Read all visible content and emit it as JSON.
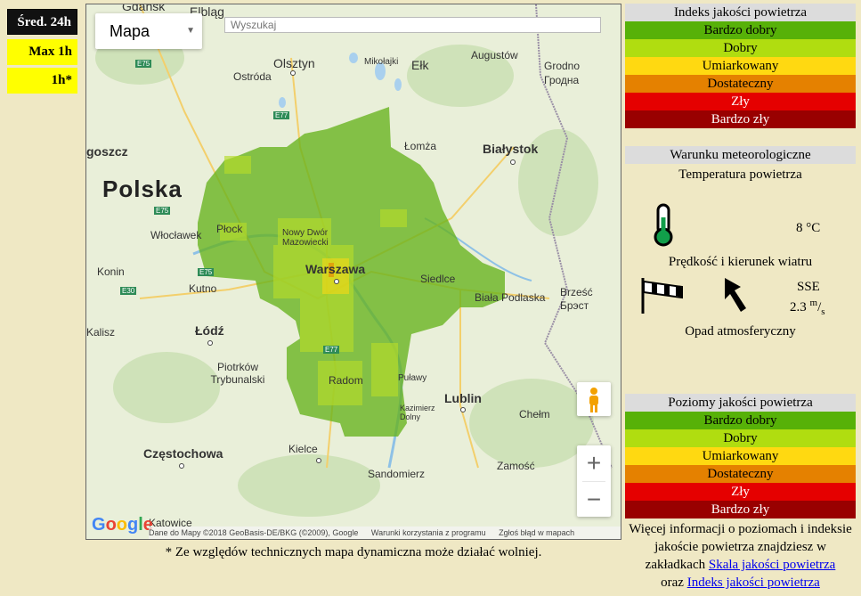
{
  "modes": {
    "avg24": "Śred. 24h",
    "max1h": "Max 1h",
    "h1": "1h*"
  },
  "map": {
    "type_label": "Mapa",
    "search_placeholder": "Wyszukaj",
    "country": "Polska",
    "cities": {
      "gdansk": "Gdańsk",
      "elblag": "Elbląg",
      "olsztyn": "Olsztyn",
      "ostroda": "Ostróda",
      "mikolajki": "Mikołajki",
      "elk": "Ełk",
      "augustow": "Augustów",
      "grodno": "Grodno",
      "grodno_by": "Гродна",
      "lomza": "Łomża",
      "bialystok": "Białystok",
      "goszcz": "goszcz",
      "plock": "Płock",
      "wloclawek": "Włocławek",
      "nowydwor": "Nowy Dwór Mazowiecki",
      "warszawa": "Warszawa",
      "siedlce": "Siedlce",
      "biala": "Biała Podlaska",
      "brzesc": "Brześć",
      "brest_by": "Брэст",
      "konin": "Konin",
      "kutno": "Kutno",
      "kalisz": "Kalisz",
      "lodz": "Łódź",
      "piotrkow": "Piotrków Trybunalski",
      "radom": "Radom",
      "pulawy": "Puławy",
      "kazimierz": "Kazimierz Dolny",
      "lublin": "Lublin",
      "chelm": "Chełm",
      "czestochowa": "Częstochowa",
      "kielce": "Kielce",
      "sandomierz": "Sandomierz",
      "zamosc": "Zamość",
      "katowice": "Katowice"
    },
    "roads": {
      "e75a": "E75",
      "e77a": "E77",
      "e75b": "E75",
      "e75c": "E75",
      "e30": "E30",
      "e77b": "E77"
    },
    "attribution": {
      "data": "Dane do Mapy ©2018 GeoBasis-DE/BKG (©2009), Google",
      "terms": "Warunki korzystania z programu",
      "report": "Zgłoś błąd w mapach"
    },
    "google": "Google"
  },
  "note": "* Ze względów technicznych mapa dynamiczna może działać wolniej.",
  "index_panel": {
    "title": "Indeks jakości powietrza",
    "levels": [
      {
        "label": "Bardzo dobry",
        "color": "#57b108",
        "text": "#000000"
      },
      {
        "label": "Dobry",
        "color": "#b0dd10",
        "text": "#000000"
      },
      {
        "label": "Umiarkowany",
        "color": "#ffd911",
        "text": "#000000"
      },
      {
        "label": "Dostateczny",
        "color": "#e58100",
        "text": "#000000"
      },
      {
        "label": "Zły",
        "color": "#e50000",
        "text": "#ffffff"
      },
      {
        "label": "Bardzo zły",
        "color": "#990000",
        "text": "#ffffff"
      }
    ]
  },
  "meteo": {
    "title": "Warunku meteorologiczne",
    "temp_label": "Temperatura powietrza",
    "temp_value": "8 °C",
    "wind_label": "Prędkość i kierunek wiatru",
    "wind_dir": "SSE",
    "wind_speed": "2.3",
    "wind_unit_top": "m",
    "wind_unit_bottom": "s",
    "precip_label": "Opad atmosferyczny"
  },
  "levels_panel": {
    "title": "Poziomy jakości powietrza",
    "levels": [
      {
        "label": "Bardzo dobry",
        "color": "#57b108",
        "text": "#000000"
      },
      {
        "label": "Dobry",
        "color": "#b0dd10",
        "text": "#000000"
      },
      {
        "label": "Umiarkowany",
        "color": "#ffd911",
        "text": "#000000"
      },
      {
        "label": "Dostateczny",
        "color": "#e58100",
        "text": "#000000"
      },
      {
        "label": "Zły",
        "color": "#e50000",
        "text": "#ffffff"
      },
      {
        "label": "Bardzo zły",
        "color": "#990000",
        "text": "#ffffff"
      }
    ]
  },
  "info": {
    "text1": "Więcej informacji o poziomach i indeksie jakoście powietrza znajdziesz w zakładkach",
    "link1": "Skala jakości powietrza",
    "text2": "oraz",
    "link2": "Indeks jakości powietrza"
  }
}
